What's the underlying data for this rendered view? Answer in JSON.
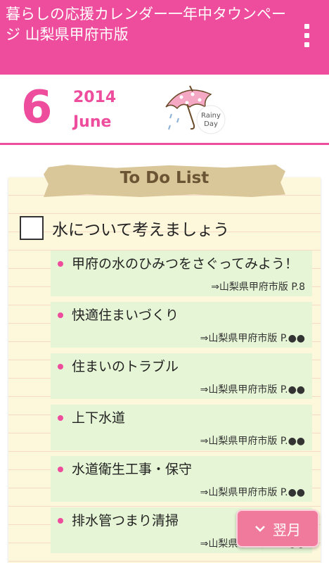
{
  "appbar": {
    "title": "暮らしの応援カレンダー一年中タウンページ 山梨県甲府市版",
    "overflow_icon": "overflow-menu-icon",
    "color": "#ee4c9c"
  },
  "date": {
    "day": "6",
    "year": "2014",
    "month": "June",
    "weather": {
      "icon": "umbrella-icon",
      "label_line1": "Rainy",
      "label_line2": "Day"
    }
  },
  "todo": {
    "heading": "To Do List",
    "main_task": "水について考えましょう",
    "items": [
      {
        "text": "甲府の水のひみつをさぐってみよう！",
        "ref": "⇒山梨県甲府市版 P.8"
      },
      {
        "text": "快適住まいづくり",
        "ref": "⇒山梨県甲府市版 P.●●"
      },
      {
        "text": "住まいのトラブル",
        "ref": "⇒山梨県甲府市版 P.●●"
      },
      {
        "text": "上下水道",
        "ref": "⇒山梨県甲府市版 P.●●"
      },
      {
        "text": "水道衛生工事・保守",
        "ref": "⇒山梨県甲府市版 P.●●"
      },
      {
        "text": "排水管つまり清掃",
        "ref": "⇒山梨県甲府市版 P.●●"
      }
    ]
  },
  "nav": {
    "next_label": "翌月",
    "next_icon": "chevron-down-icon"
  }
}
